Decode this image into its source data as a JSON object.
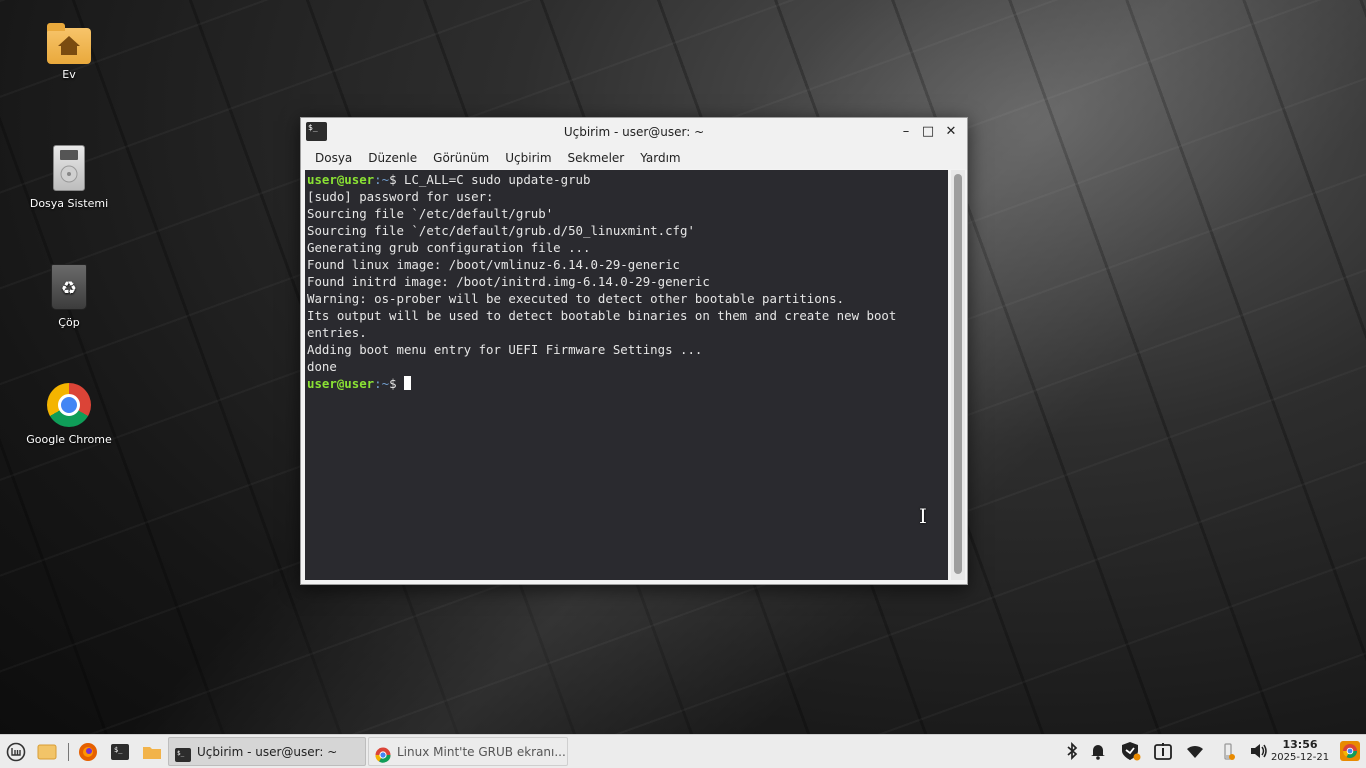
{
  "desktop": {
    "icons": [
      {
        "label": "Ev"
      },
      {
        "label": "Dosya Sistemi"
      },
      {
        "label": "Çöp"
      },
      {
        "label": "Google Chrome"
      }
    ]
  },
  "window": {
    "title": "Uçbirim - user@user: ~",
    "icon_text": "$_",
    "controls": {
      "minimize": "–",
      "maximize": "□",
      "close": "✕"
    },
    "menu": [
      "Dosya",
      "Düzenle",
      "Görünüm",
      "Uçbirim",
      "Sekmeler",
      "Yardım"
    ]
  },
  "terminal": {
    "prompt_user": "user@user",
    "prompt_path": ":~",
    "prompt_symbol": "$ ",
    "command": "LC_ALL=C sudo update-grub",
    "output": [
      "[sudo] password for user:",
      "Sourcing file `/etc/default/grub'",
      "Sourcing file `/etc/default/grub.d/50_linuxmint.cfg'",
      "Generating grub configuration file ...",
      "Found linux image: /boot/vmlinuz-6.14.0-29-generic",
      "Found initrd image: /boot/initrd.img-6.14.0-29-generic",
      "Warning: os-prober will be executed to detect other bootable partitions.",
      "Its output will be used to detect bootable binaries on them and create new boot",
      "entries.",
      "Adding boot menu entry for UEFI Firmware Settings ...",
      "done"
    ]
  },
  "taskbar": {
    "tasks": [
      {
        "label": "Uçbirim - user@user: ~",
        "icon": "terminal-icon"
      },
      {
        "label": "Linux Mint'te GRUB ekranı...",
        "icon": "chrome-icon"
      }
    ],
    "tray_icons": [
      "bluetooth-icon",
      "notification-bell-icon",
      "shield-icon",
      "update-icon",
      "wifi-icon",
      "battery-icon",
      "volume-icon"
    ],
    "clock": {
      "time": "13:56",
      "date": "2025-12-21"
    }
  },
  "colors": {
    "prompt_user": "#8ae234",
    "prompt_path": "#729fcf",
    "terminal_bg": "#2a2a2f",
    "panel_bg": "#ececec"
  }
}
